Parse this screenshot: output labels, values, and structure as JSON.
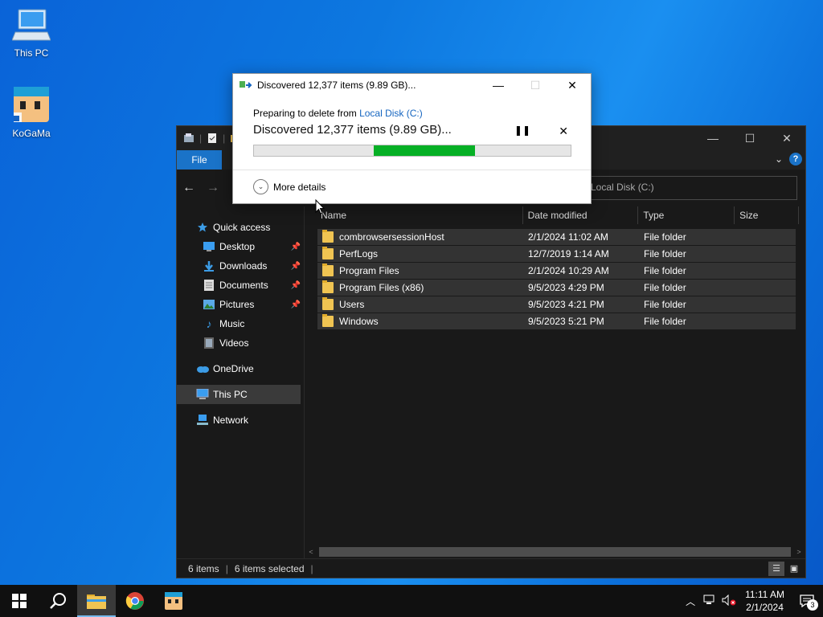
{
  "desktop": {
    "icons": [
      {
        "label": "This PC"
      },
      {
        "label": "KoGaMa"
      }
    ]
  },
  "explorer": {
    "ribbon": {
      "file_tab": "File"
    },
    "address": "Local Disk (C:)",
    "nav_pane": {
      "quick_access": "Quick access",
      "items": [
        {
          "label": "Desktop",
          "pinned": true
        },
        {
          "label": "Downloads",
          "pinned": true
        },
        {
          "label": "Documents",
          "pinned": true
        },
        {
          "label": "Pictures",
          "pinned": true
        },
        {
          "label": "Music",
          "pinned": false
        },
        {
          "label": "Videos",
          "pinned": false
        }
      ],
      "onedrive": "OneDrive",
      "this_pc": "This PC",
      "network": "Network"
    },
    "columns": {
      "name": "Name",
      "date": "Date modified",
      "type": "Type",
      "size": "Size"
    },
    "files": [
      {
        "name": "combrowsersessionHost",
        "date": "2/1/2024 11:02 AM",
        "type": "File folder"
      },
      {
        "name": "PerfLogs",
        "date": "12/7/2019 1:14 AM",
        "type": "File folder"
      },
      {
        "name": "Program Files",
        "date": "2/1/2024 10:29 AM",
        "type": "File folder"
      },
      {
        "name": "Program Files (x86)",
        "date": "9/5/2023 4:29 PM",
        "type": "File folder"
      },
      {
        "name": "Users",
        "date": "9/5/2023 4:21 PM",
        "type": "File folder"
      },
      {
        "name": "Windows",
        "date": "9/5/2023 5:21 PM",
        "type": "File folder"
      }
    ],
    "status": {
      "items": "6 items",
      "selected": "6 items selected"
    }
  },
  "dialog": {
    "title": "Discovered 12,377 items (9.89 GB)...",
    "preparing_prefix": "Preparing to delete from ",
    "preparing_target": "Local Disk (C:)",
    "discovered": "Discovered 12,377 items (9.89 GB)...",
    "progress": {
      "indeterminate": true,
      "segment_start": 0.377,
      "segment_end": 0.697
    },
    "more_details": "More details"
  },
  "taskbar": {
    "time": "11:11 AM",
    "date": "2/1/2024",
    "notification_count": "3"
  }
}
